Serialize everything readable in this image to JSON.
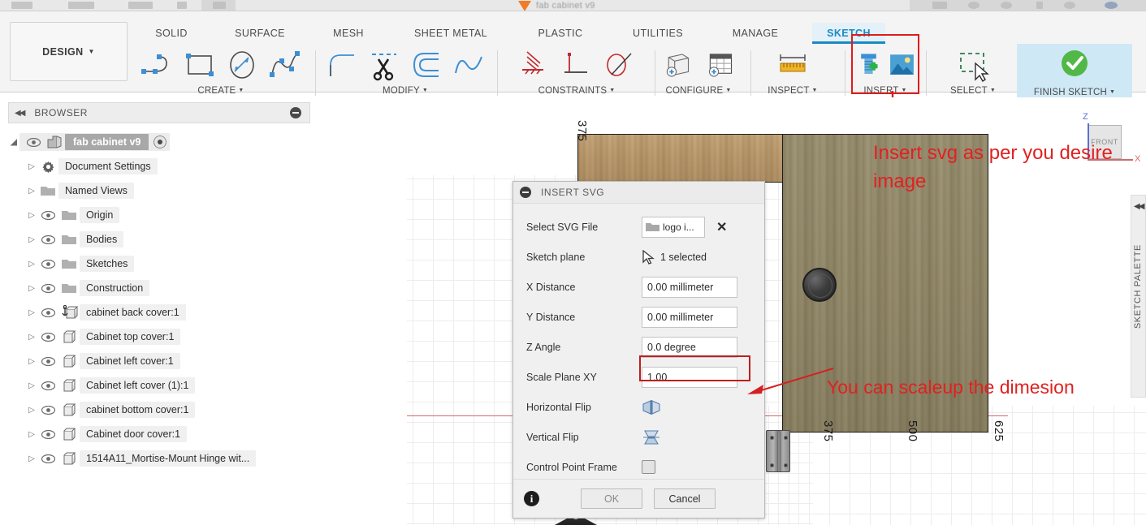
{
  "window": {
    "document_title": "fab cabinet v9"
  },
  "ribbon": {
    "workspace_button": "DESIGN",
    "tabs": [
      {
        "label": "SOLID",
        "active": false
      },
      {
        "label": "SURFACE",
        "active": false
      },
      {
        "label": "MESH",
        "active": false
      },
      {
        "label": "SHEET METAL",
        "active": false
      },
      {
        "label": "PLASTIC",
        "active": false
      },
      {
        "label": "UTILITIES",
        "active": false
      },
      {
        "label": "MANAGE",
        "active": false
      },
      {
        "label": "SKETCH",
        "active": true
      }
    ],
    "groups": [
      {
        "label": "CREATE",
        "has_caret": true
      },
      {
        "label": "MODIFY",
        "has_caret": true
      },
      {
        "label": "CONSTRAINTS",
        "has_caret": true
      },
      {
        "label": "CONFIGURE",
        "has_caret": true
      },
      {
        "label": "INSPECT",
        "has_caret": true
      },
      {
        "label": "INSERT",
        "has_caret": true
      },
      {
        "label": "SELECT",
        "has_caret": true
      },
      {
        "label": "FINISH SKETCH",
        "has_caret": true
      }
    ]
  },
  "browser": {
    "title": "BROWSER",
    "root": "fab cabinet v9",
    "items": [
      {
        "label": "Document Settings",
        "icon": "gear-icon",
        "has_eye": false
      },
      {
        "label": "Named Views",
        "icon": "folder-icon",
        "has_eye": false
      },
      {
        "label": "Origin",
        "icon": "folder-icon",
        "has_eye": true
      },
      {
        "label": "Bodies",
        "icon": "folder-icon",
        "has_eye": true
      },
      {
        "label": "Sketches",
        "icon": "folder-icon",
        "has_eye": true
      },
      {
        "label": "Construction",
        "icon": "folder-icon",
        "has_eye": true
      },
      {
        "label": "cabinet back cover:1",
        "icon": "anchored-component-icon",
        "has_eye": true
      },
      {
        "label": "Cabinet top cover:1",
        "icon": "component-icon",
        "has_eye": true
      },
      {
        "label": "Cabinet left cover:1",
        "icon": "component-icon",
        "has_eye": true
      },
      {
        "label": "Cabinet left cover (1):1",
        "icon": "component-icon",
        "has_eye": true
      },
      {
        "label": "cabinet bottom cover:1",
        "icon": "component-icon",
        "has_eye": true
      },
      {
        "label": "Cabinet door   cover:1",
        "icon": "component-icon",
        "has_eye": true
      },
      {
        "label": "1514A11_Mortise-Mount Hinge wit...",
        "icon": "component-icon",
        "has_eye": true
      }
    ]
  },
  "dialog": {
    "title": "INSERT SVG",
    "fields": {
      "select_svg_file": {
        "label": "Select SVG File",
        "value": "logo i..."
      },
      "sketch_plane": {
        "label": "Sketch plane",
        "value": "1 selected"
      },
      "x_distance": {
        "label": "X Distance",
        "value": "0.00 millimeter"
      },
      "y_distance": {
        "label": "Y Distance",
        "value": "0.00 millimeter"
      },
      "z_angle": {
        "label": "Z Angle",
        "value": "0.0 degree"
      },
      "scale_plane_xy": {
        "label": "Scale Plane XY",
        "value": "1.00"
      },
      "horizontal_flip": {
        "label": "Horizontal Flip"
      },
      "vertical_flip": {
        "label": "Vertical Flip"
      },
      "control_point_frame": {
        "label": "Control Point Frame",
        "checked": false
      }
    },
    "ok_label": "OK",
    "cancel_label": "Cancel"
  },
  "viewport": {
    "dimension_labels": [
      "375",
      "375",
      "500",
      "625"
    ],
    "viewcube_face": "FRONT",
    "axis_z": "Z",
    "axis_x": "X"
  },
  "sketch_palette": {
    "label": "SKETCH PALETTE"
  },
  "annotations": [
    {
      "text": "Insert svg as per you desire",
      "line2": "image"
    },
    {
      "text": "You can scaleup the dimesion"
    }
  ],
  "colors": {
    "accent_blue": "#1a8ac4",
    "annotation_red": "#e12121",
    "highlight_red": "#e01b1b",
    "finish_green": "#51b848",
    "wood_light": "#bb9a6d",
    "wood_dark": "#958b6c"
  }
}
